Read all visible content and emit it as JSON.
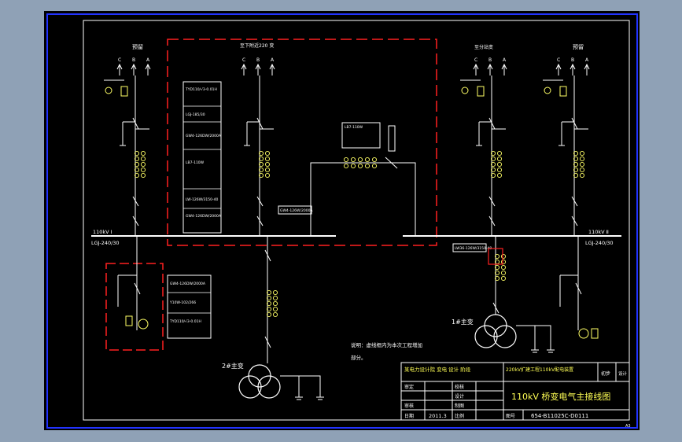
{
  "colors": {
    "background": "#8fa1b6",
    "canvas": "#000000",
    "line": "#ffffff",
    "symbol": "#ffff66",
    "highlight": "#ff2020",
    "title": "#ffff55",
    "border": "#2233ff"
  },
  "labels": {
    "spare_left": "预留",
    "spare_right": "预留",
    "to_220": "至下附近220 变",
    "to_sub": "至分站变",
    "phase_c": "C",
    "phase_b": "B",
    "phase_a": "A",
    "bus_left_name": "110kV Ⅰ",
    "bus_left_cable": "LGJ-240/30",
    "bus_right_name": "110kV Ⅱ",
    "bus_right_cable": "LGJ-240/30",
    "dev_ct": "LB7-110W",
    "dev_gw4": "GW4-126DW/2000A",
    "dev_lgj": "LGJ-185/30",
    "dev_fuse": "LW-126W/3150-40",
    "dev_wire": "GW4-126W/2000A",
    "dev_lw36": "LW36-126W/3150-40",
    "dev_gw4b": "GW4-126DW/2000A",
    "dev_arrester": "Y10W-102/266",
    "dev_pt": "TYD110/√3-0.01H",
    "dev_bus_tie": "GW4-126W/2000A",
    "trans2": "2#主变",
    "trans1": "1#主变",
    "note_line1": "说明：虚线框内为本次工程增加",
    "note_line2": "部分。",
    "tb_company": "某电力设计院 变电 设计 阶段",
    "tb_project": "220kV扩建工程110kV配电装置",
    "tb_stage": "初步",
    "tb_design": "设计",
    "tb_approve": "审定",
    "tb_review": "审核",
    "tb_check": "校核",
    "tb_draw": "制图",
    "tb_date_label": "日期",
    "tb_date": "2011.3",
    "tb_scale": "比例",
    "tb_title": "110kV 桥变电气主接线图",
    "tb_drawing_no_label": "图号",
    "tb_drawing_no": "654-B11025C-D0111",
    "sheet_size": "A3"
  }
}
